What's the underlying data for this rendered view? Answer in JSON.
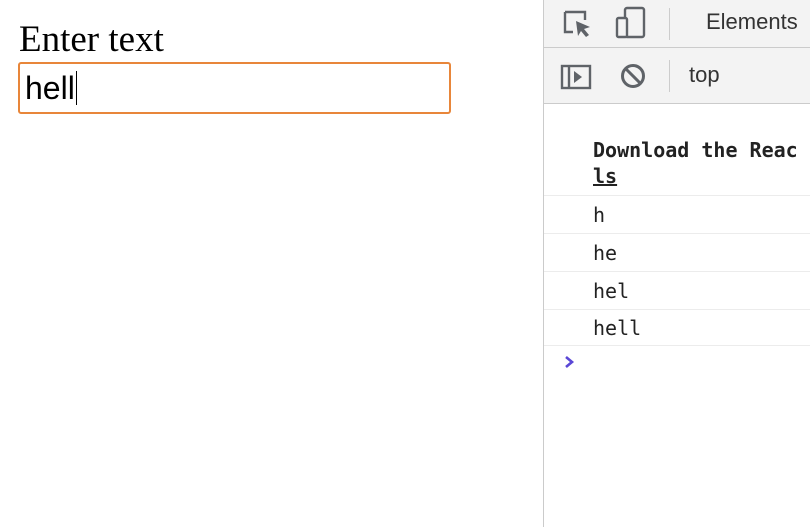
{
  "page": {
    "label": "Enter text",
    "input_value": "hell"
  },
  "devtools": {
    "toolbar": {
      "inspect_icon": "inspect-element-icon",
      "device_icon": "device-toggle-icon",
      "elements_tab": "Elements"
    },
    "console_toolbar": {
      "sidebar_icon": "sidebar-toggle-icon",
      "clear_icon": "clear-console-icon",
      "context": "top"
    },
    "console": {
      "download_line1": "Download the Reac",
      "download_line2": "ls",
      "logs": [
        "h",
        "he",
        "hel",
        "hell"
      ],
      "prompt_icon": "chevron-right-icon"
    }
  },
  "colors": {
    "input_focus_border": "#e8863a",
    "prompt_chevron": "#5a47d6",
    "toolbar_bg": "#f3f3f3"
  }
}
